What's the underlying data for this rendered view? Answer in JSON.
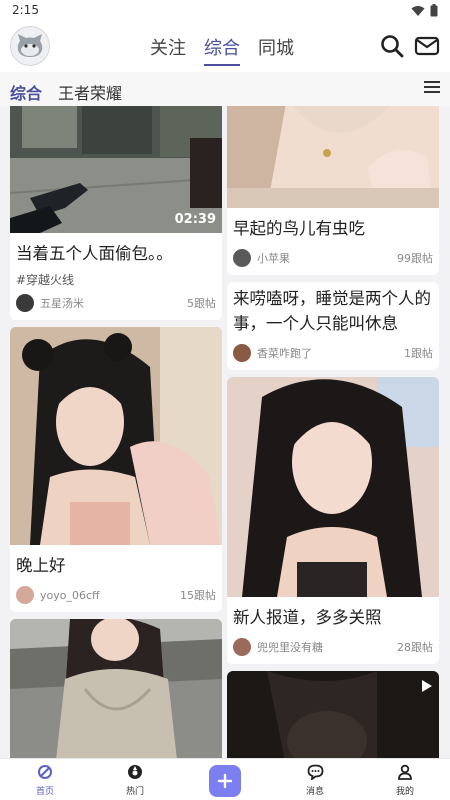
{
  "status": {
    "time": "2:15"
  },
  "header": {
    "tabs": [
      {
        "label": "关注",
        "active": false
      },
      {
        "label": "综合",
        "active": true
      },
      {
        "label": "同城",
        "active": false
      }
    ]
  },
  "subtabs": [
    {
      "label": "综合",
      "active": true
    },
    {
      "label": "王者荣耀",
      "active": false
    }
  ],
  "feed": {
    "left": [
      {
        "title": "当着五个人面偷包。。",
        "tag": "#穿越火线",
        "author": "五星汤米",
        "replies": "5跟帖",
        "duration": "02:39"
      },
      {
        "title": "晚上好",
        "author": "yoyo_06cff",
        "replies": "15跟帖"
      }
    ],
    "right": [
      {
        "title": "早起的鸟儿有虫吃",
        "author": "小苹果",
        "replies": "99跟帖"
      },
      {
        "title": "来唠嗑呀，睡觉是两个人的事，一个人只能叫休息",
        "author": "香菜咋跑了",
        "replies": "1跟帖"
      },
      {
        "title": "新人报道，多多关照",
        "author": "兜兜里没有糖",
        "replies": "28跟帖"
      }
    ]
  },
  "bottom_nav": {
    "items": [
      {
        "label": "首页",
        "icon": "home-icon",
        "active": true
      },
      {
        "label": "热门",
        "icon": "hot-icon",
        "active": false
      },
      {
        "label": "消息",
        "icon": "message-icon",
        "active": false
      },
      {
        "label": "我的",
        "icon": "profile-icon",
        "active": false
      }
    ]
  },
  "colors": {
    "accent": "#4a4f9c",
    "add_button": "#7b7ff0"
  }
}
